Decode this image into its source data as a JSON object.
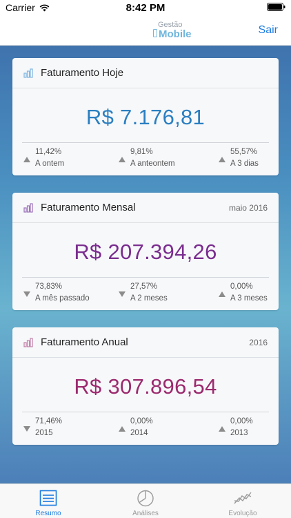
{
  "status": {
    "carrier": "Carrier",
    "time": "8:42 PM"
  },
  "nav": {
    "logo_top": "Gestão",
    "logo_bottom": "Mobile",
    "logout": "Sair"
  },
  "cards": [
    {
      "title": "Faturamento Hoje",
      "period": "",
      "value": "R$ 7.176,81",
      "value_color": "#2a7fc1",
      "icon_color": "#7fb4e0",
      "stats": [
        {
          "percent": "11,42%",
          "label": "A ontem",
          "direction": "up"
        },
        {
          "percent": "9,81%",
          "label": "A anteontem",
          "direction": "up"
        },
        {
          "percent": "55,57%",
          "label": "A 3 dias",
          "direction": "up"
        }
      ]
    },
    {
      "title": "Faturamento Mensal",
      "period": "maio 2016",
      "value": "R$ 207.394,26",
      "value_color": "#7a2d8f",
      "icon_color": "#9b6fb8",
      "stats": [
        {
          "percent": "73,83%",
          "label": "A mês passado",
          "direction": "down"
        },
        {
          "percent": "27,57%",
          "label": "A 2 meses",
          "direction": "down"
        },
        {
          "percent": "0,00%",
          "label": "A 3 meses",
          "direction": "up"
        }
      ]
    },
    {
      "title": "Faturamento Anual",
      "period": "2016",
      "value": "R$ 307.896,54",
      "value_color": "#9b2a6e",
      "icon_color": "#c07fa8",
      "stats": [
        {
          "percent": "71,46%",
          "label": "2015",
          "direction": "down"
        },
        {
          "percent": "0,00%",
          "label": "2014",
          "direction": "up"
        },
        {
          "percent": "0,00%",
          "label": "2013",
          "direction": "up"
        }
      ]
    }
  ],
  "tabs": [
    {
      "label": "Resumo",
      "icon": "list-icon",
      "active": true
    },
    {
      "label": "Análises",
      "icon": "pie-chart-icon",
      "active": false
    },
    {
      "label": "Evolução",
      "icon": "line-chart-icon",
      "active": false
    }
  ],
  "colors": {
    "accent": "#1a7be0",
    "arrow": "#8c8c8c"
  }
}
